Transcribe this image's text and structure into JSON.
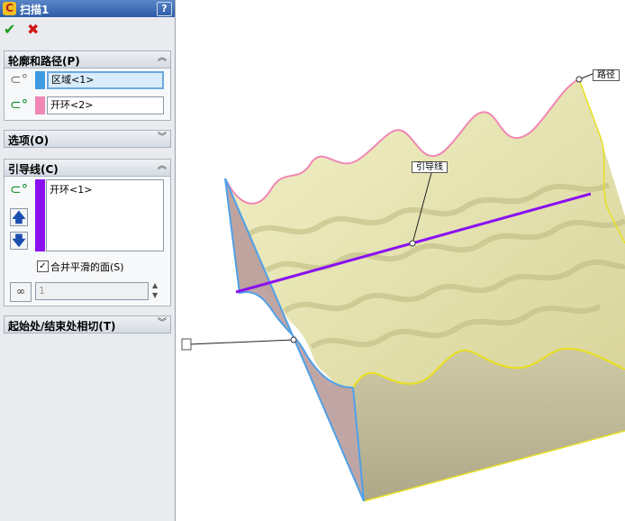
{
  "titlebar": {
    "title": "扫描1",
    "help": "?"
  },
  "actions": {
    "ok": "✔",
    "cancel": "✖"
  },
  "profile_path": {
    "header": "轮廓和路径(P)",
    "profile_value": "区域<1>",
    "path_value": "开环<2>",
    "profile_color": "#3f9be0",
    "path_color": "#f087b4"
  },
  "options": {
    "header": "选项(O)"
  },
  "guides": {
    "header": "引导线(C)",
    "items": [
      "开环<1>"
    ],
    "guide_color": "#8a10f0",
    "merge_label": "合并平滑的面(S)",
    "merge_checked": true,
    "count_value": "1"
  },
  "tangency": {
    "header": "起始处/结束处相切(T)"
  },
  "viewport": {
    "label_path": "路径",
    "label_guide": "引导线"
  }
}
